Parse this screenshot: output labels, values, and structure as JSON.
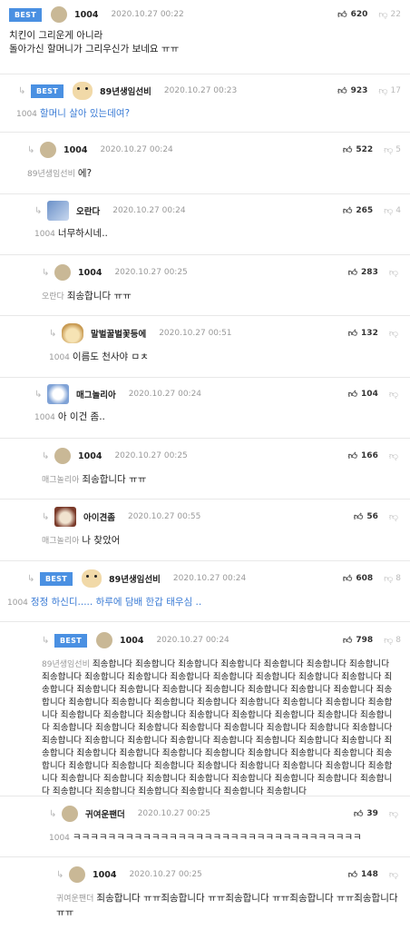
{
  "comments": [
    {
      "best": "BEST",
      "nick": "1004",
      "date": "2020.10.27 00:22",
      "up": "620",
      "down": "22",
      "lines": [
        "치킨이 그리운게 아니라",
        "돌아가신 할머니가 그리우신가 보네요 ㅠㅠ"
      ]
    },
    {
      "best": "BEST",
      "nick": "89년생임선비",
      "date": "2020.10.27 00:23",
      "up": "923",
      "down": "17",
      "mention": "1004",
      "text": "할머니 살아 있는데여?"
    },
    {
      "nick": "1004",
      "date": "2020.10.27 00:24",
      "up": "522",
      "down": "5",
      "mention": "89년생임선비",
      "text": "에?"
    },
    {
      "nick": "오란다",
      "date": "2020.10.27 00:24",
      "up": "265",
      "down": "4",
      "mention": "1004",
      "text": "너무하시네.."
    },
    {
      "nick": "1004",
      "date": "2020.10.27 00:25",
      "up": "283",
      "down": "",
      "mention": "오란다",
      "text": "죄송합니다 ㅠㅠ"
    },
    {
      "nick": "말벌꿀벌꽃등에",
      "date": "2020.10.27 00:51",
      "up": "132",
      "down": "",
      "mention": "1004",
      "text": "이름도 천사야 ㅁㅊ"
    },
    {
      "nick": "매그놀리아",
      "date": "2020.10.27 00:24",
      "up": "104",
      "down": "",
      "mention": "1004",
      "text": "아 이건 좀.."
    },
    {
      "nick": "1004",
      "date": "2020.10.27 00:25",
      "up": "166",
      "down": "",
      "mention": "매그놀리아",
      "text": "죄송합니다 ㅠㅠ"
    },
    {
      "nick": "아이견좀",
      "date": "2020.10.27 00:55",
      "up": "56",
      "down": "",
      "mention": "매그놀리아",
      "text": "나 찾았어"
    },
    {
      "best": "BEST",
      "nick": "89년생임선비",
      "date": "2020.10.27 00:24",
      "up": "608",
      "down": "8",
      "mention": "1004",
      "text": "정정 하신디..... 하루에 담배 한갑 태우심 .."
    },
    {
      "best": "BEST",
      "nick": "1004",
      "date": "2020.10.27 00:24",
      "up": "798",
      "down": "8",
      "mention": "89년생임선비",
      "text": "죄송합니다 죄송합니다 죄송합니다 죄송합니다 죄송합니다 죄송합니다 죄송합니다 죄송합니다 죄송합니다 죄송합니다 죄송합니다 죄송합니다 죄송합니다 죄송합니다 죄송합니다 죄송합니다 죄송합니다 죄송합니다 죄송합니다 죄송합니다 죄송합니다 죄송합니다 죄송합니다 죄송합니다 죄송합니다 죄송합니다 죄송합니다 죄송합니다 죄송합니다 죄송합니다 죄송합니다 죄송합니다 죄송합니다 죄송합니다 죄송합니다 죄송합니다 죄송합니다 죄송합니다 죄송합니다 죄송합니다 죄송합니다 죄송합니다 죄송합니다 죄송합니다 죄송합니다 죄송합니다 죄송합니다 죄송합니다 죄송합니다 죄송합니다 죄송합니다 죄송합니다 죄송합니다 죄송합니다 죄송합니다 죄송합니다 죄송합니다 죄송합니다 죄송합니다 죄송합니다 죄송합니다 죄송합니다 죄송합니다 죄송합니다 죄송합니다 죄송합니다 죄송합니다 죄송합니다 죄송합니다 죄송합니다 죄송합니다 죄송합니다 죄송합니다 죄송합니다 죄송합니다 죄송합니다 죄송합니다 죄송합니다 죄송합니다 죄송합니다 죄송합니다 죄송합니다 죄송합니다 죄송합니다 죄송합니다 죄송합니다 죄송합니다"
    },
    {
      "nick": "귀여운팬더",
      "date": "2020.10.27 00:25",
      "up": "39",
      "down": "",
      "mention": "1004",
      "text": "ㅋㅋㅋㅋㅋㅋㅋㅋㅋㅋㅋㅋㅋㅋㅋㅋㅋㅋㅋㅋㅋㅋㅋㅋㅋㅋㅋㅋㅋㅋㅋㅋㅋ"
    },
    {
      "nick": "1004",
      "date": "2020.10.27 00:25",
      "up": "148",
      "down": "",
      "mention": "귀여운팬더",
      "text": "죄송합니다 ㅠㅠ죄송합니다 ㅠㅠ죄송합니다 ㅠㅠ죄송합니다 ㅠㅠ죄송합니다 ㅠㅠ"
    }
  ]
}
